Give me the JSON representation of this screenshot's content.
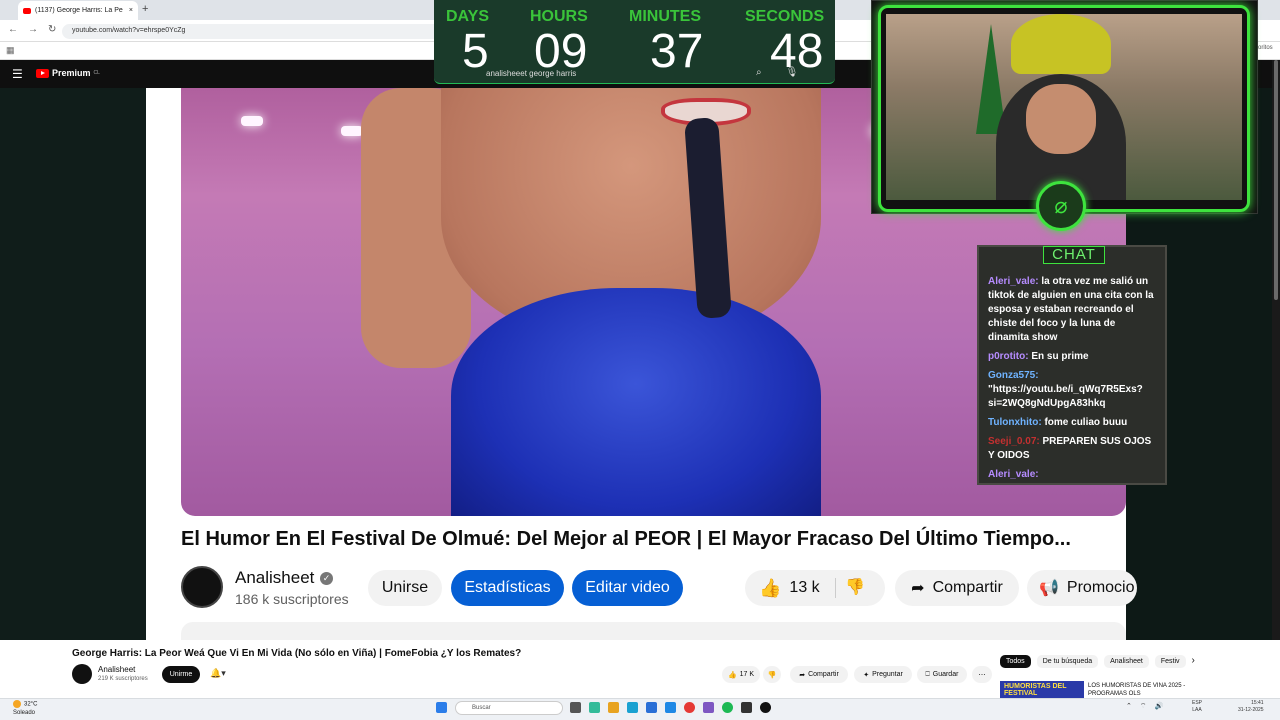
{
  "browser": {
    "tab_title": "(1137) George Harris: La Pe",
    "new_tab": "+",
    "url": "youtube.com/watch?v=ehrspe0YcZg",
    "favorites_label": "favoritos"
  },
  "youtube": {
    "logo_text": "Premium",
    "region": "CL"
  },
  "countdown": {
    "days_label": "DAYS",
    "days": "5",
    "hours_label": "HOURS",
    "hours": "09",
    "minutes_label": "MINUTES",
    "minutes": "37",
    "seconds_label": "SECONDS",
    "seconds": "48",
    "search_text": "analisheeet george harris"
  },
  "video": {
    "title": "El Humor En El Festival De Olmué: Del Mejor al PEOR | El Mayor Fracaso Del Último Tiempo...",
    "channel": "Analisheet",
    "subscribers": "186 k suscriptores",
    "join_label": "Unirse",
    "stats_label": "Estadísticas",
    "edit_label": "Editar video",
    "likes": "13 k",
    "share_label": "Compartir",
    "promo_label": "Promocio"
  },
  "chat": {
    "title": "CHAT",
    "messages": [
      {
        "user": "Aleri_vale:",
        "text": " la otra vez me salió un tiktok de alguien en una cita con la esposa y estaban recreando el chiste del foco y la luna de dinamita show"
      },
      {
        "user": "p0rotito:",
        "text": " En su prime"
      },
      {
        "user": "Gonza575:",
        "text": " \"https://youtu.be/i_qWq7R5Exs?si=2WQ8gNdUpgA83hkq"
      },
      {
        "user": "Tulonxhito:",
        "text": " fome culiao buuu"
      },
      {
        "user": "Seeji_0.07:",
        "text": " PREPAREN SUS OJOS Y OIDOS"
      },
      {
        "user": "Aleri_vale:",
        "text": ""
      }
    ]
  },
  "miniplayer": {
    "title": "George Harris: La Peor Weá Que Vi En Mi Vida (No sólo en Viña) | FomeFobia ¿Y los Remates?",
    "channel": "Analisheet",
    "subscribers": "219 K suscriptores",
    "join_label": "Unirme",
    "likes": "17 K",
    "share_label": "Compartir",
    "ask_label": "Preguntar",
    "save_label": "Guardar",
    "chips": [
      "Todos",
      "De tu búsqueda",
      "Analisheet",
      "Festiv"
    ],
    "rec_thumb_text": "HUMORISTAS DEL FESTIVAL",
    "rec_title": "LOS HUMORISTAS DE VIÑA 2025 - PROGRAMAS OLS"
  },
  "taskbar": {
    "temp": "32°C",
    "condition": "Soleado",
    "badge": "3",
    "search_placeholder": "Buscar",
    "lang1": "ESP",
    "lang2": "LAA",
    "time": "15:41",
    "date": "31-12-2025"
  },
  "colors": {
    "accent_blue": "#065fd4",
    "countdown_green": "#3ac43a",
    "frame_green": "#3ee33e"
  }
}
